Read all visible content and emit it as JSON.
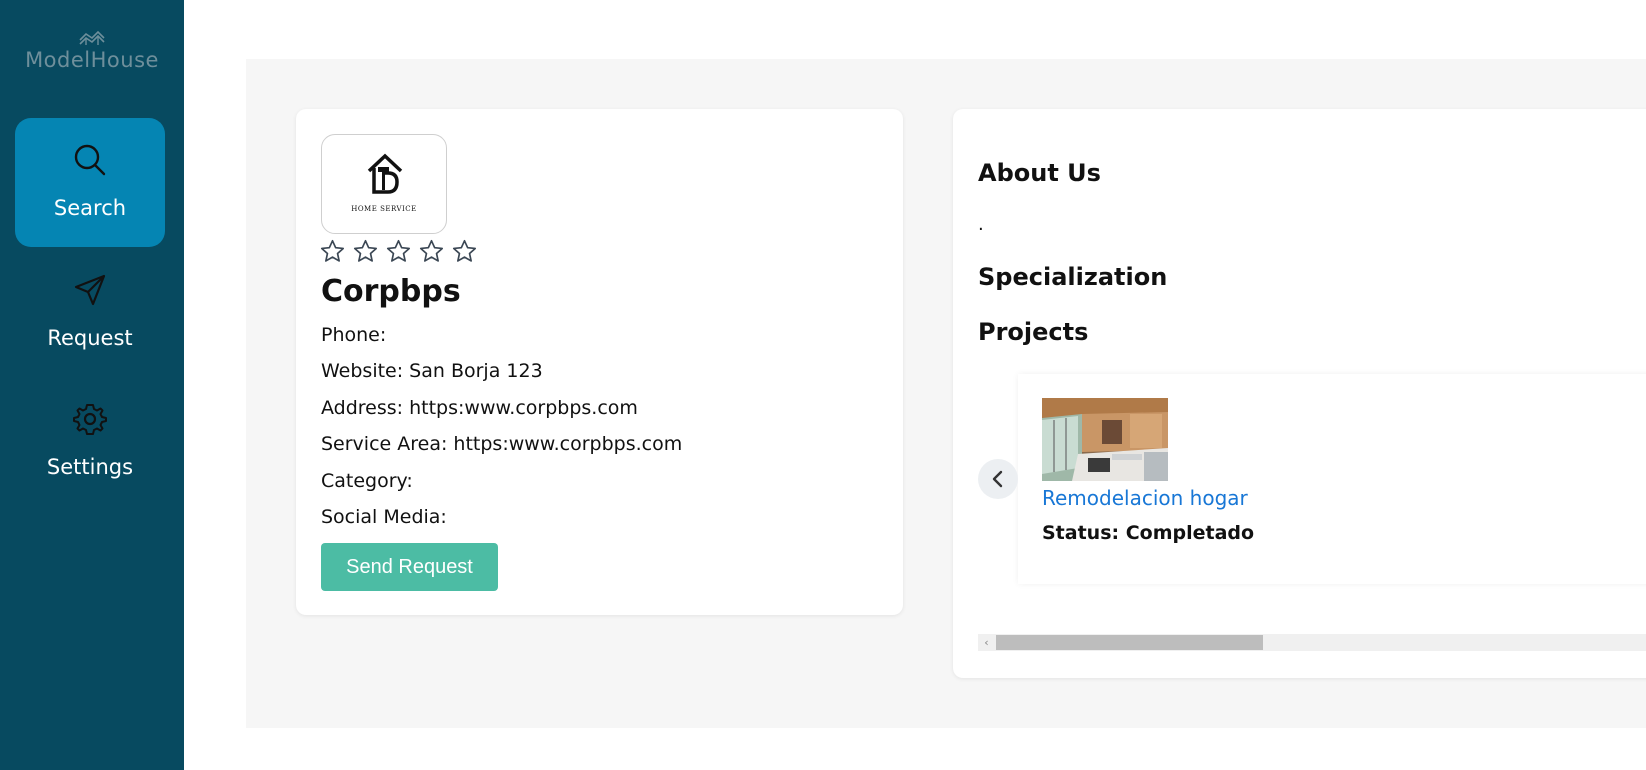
{
  "app": {
    "logo_text": "ModelHouse"
  },
  "sidebar": {
    "items": [
      {
        "label": "Search",
        "icon": "search-icon",
        "active": true
      },
      {
        "label": "Request",
        "icon": "send-icon",
        "active": false
      },
      {
        "label": "Settings",
        "icon": "gear-icon",
        "active": false
      }
    ]
  },
  "company": {
    "logo_caption": "HOME SERVICE",
    "rating": 0,
    "rating_max": 5,
    "name": "Corpbps",
    "phone": "Phone:",
    "website": "Website: San Borja 123",
    "address": "Address: https:www.corpbps.com",
    "service_area": "Service Area: https:www.corpbps.com",
    "category": "Category:",
    "social_media": "Social Media:",
    "send_request_label": "Send Request"
  },
  "details": {
    "about_title": "About Us",
    "about_text": ".",
    "specialization_title": "Specialization",
    "projects_title": "Projects",
    "projects": [
      {
        "name": "Remodelacion hogar",
        "status": "Status: Completado"
      }
    ]
  },
  "colors": {
    "sidebar_bg": "#074a60",
    "sidebar_active": "#0585b3",
    "button_bg": "#4cbca4",
    "link": "#1877d6"
  }
}
